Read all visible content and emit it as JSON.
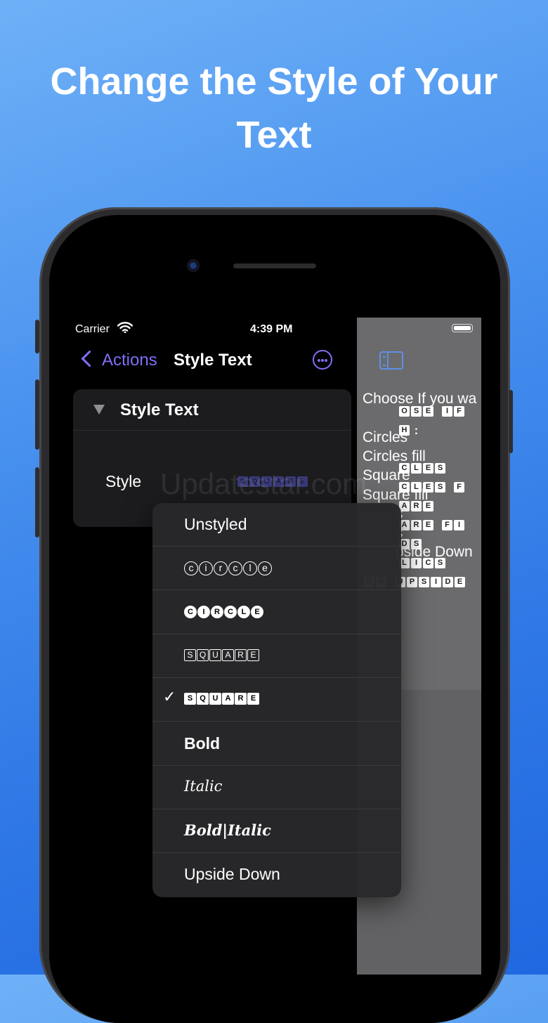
{
  "headline": {
    "line1": "Change the Style of Your",
    "line2": "Text"
  },
  "status_bar": {
    "carrier": "Carrier",
    "time": "4:39 PM"
  },
  "nav": {
    "back_label": "Actions",
    "title": "Style Text"
  },
  "card": {
    "title": "Style Text",
    "style_label": "Style",
    "style_preview": [
      "S",
      "Q",
      "U",
      "A",
      "R",
      "E"
    ]
  },
  "watermark": "Updatestar.com",
  "side_panel": {
    "lines": [
      "Choose If you wa",
      "Circles",
      "Circles fill",
      "Square",
      "Square fill",
      "s",
      "s",
      "pside Down"
    ],
    "block_rows": [
      [
        "O",
        "S",
        "E",
        " ",
        "I",
        "F"
      ],
      [
        "H",
        ":"
      ],
      [
        "C",
        "L",
        "E",
        "S"
      ],
      [
        "C",
        "L",
        "E",
        "S",
        " ",
        "F"
      ],
      [
        "A",
        "R",
        "E"
      ],
      [
        "A",
        "R",
        "E",
        " ",
        "F",
        "I"
      ],
      [
        "D",
        "S"
      ],
      [
        "L",
        "I",
        "C",
        "S"
      ],
      [
        "O",
        "R",
        " ",
        "U",
        "P",
        "S",
        "I",
        "D",
        "E"
      ]
    ]
  },
  "menu": {
    "items": [
      {
        "label": "Unstyled",
        "kind": "text"
      },
      {
        "label": "circle",
        "kind": "circle"
      },
      {
        "label": "CIRCLE",
        "kind": "circle-fill"
      },
      {
        "label": "SQUARE",
        "kind": "square"
      },
      {
        "label": "SQUARE",
        "kind": "square-fill",
        "checked": true
      },
      {
        "label": "Bold",
        "kind": "bold"
      },
      {
        "label": "Italic",
        "kind": "italic"
      },
      {
        "label": "Bold|Italic",
        "kind": "bold-italic"
      },
      {
        "label": "Upside Down",
        "kind": "text"
      }
    ],
    "check_glyph": "✓"
  },
  "colors": {
    "accent": "#7d6ff2",
    "background_top": "#6fb1f7",
    "background_bottom": "#1f68e0"
  }
}
